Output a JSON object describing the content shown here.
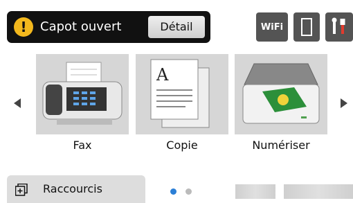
{
  "status": {
    "message": "Capot ouvert",
    "detail_label": "Détail",
    "icon": "warning-icon"
  },
  "top_icons": {
    "wifi_label": "WiFi",
    "toner": "toner-icon",
    "tools": "tools-icon"
  },
  "carousel": {
    "items": [
      {
        "label": "Fax",
        "icon": "fax-icon"
      },
      {
        "label": "Copie",
        "icon": "copy-icon"
      },
      {
        "label": "Numériser",
        "icon": "scanner-icon"
      }
    ],
    "page": 1,
    "page_count": 2
  },
  "bottom": {
    "shortcut_label": "Raccourcis"
  },
  "colors": {
    "status_bar": "#111111",
    "warning": "#f3b81d",
    "tile_bg": "#d6d6d6",
    "active_dot": "#2b7fd6",
    "inactive_dot": "#bbbbbb"
  }
}
